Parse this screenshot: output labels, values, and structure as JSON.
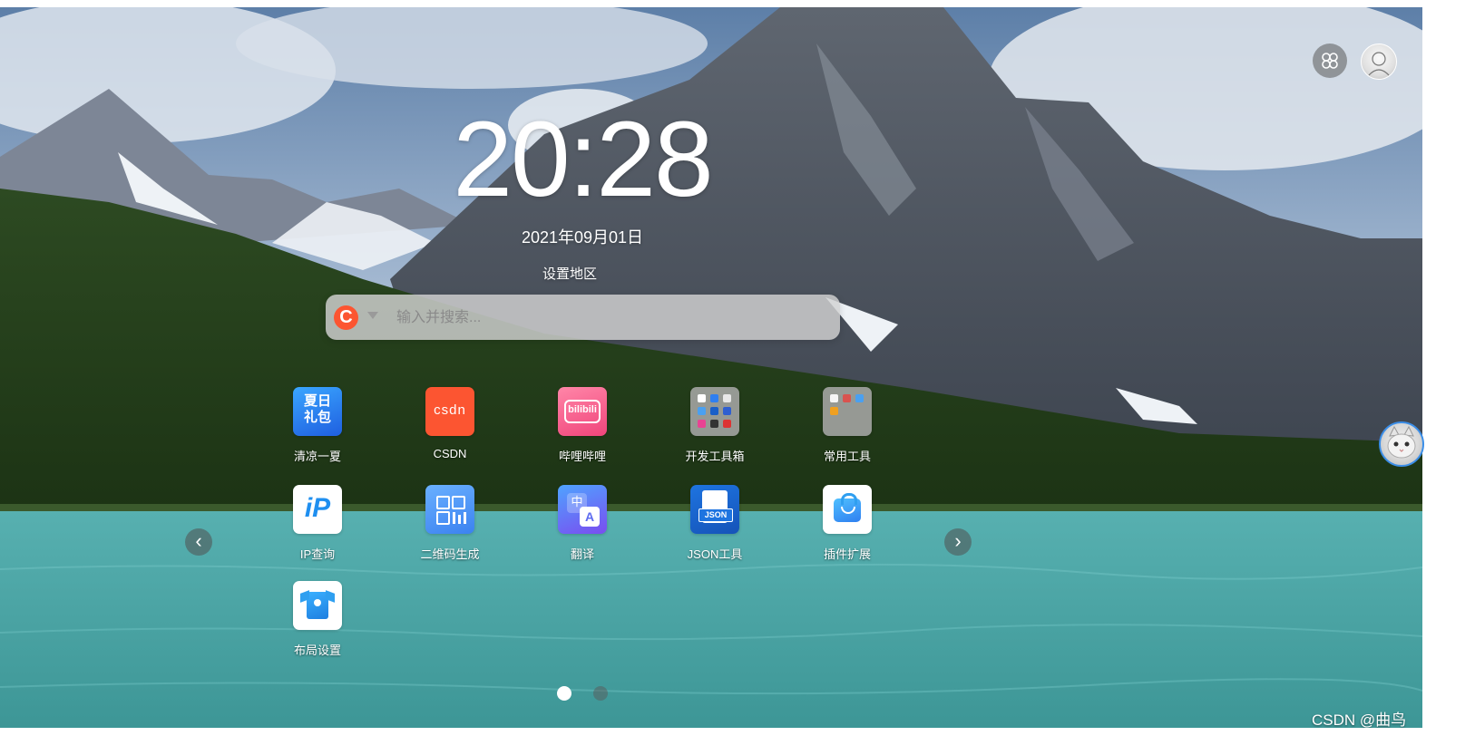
{
  "clock": {
    "time": "20:28",
    "date": "2021年09月01日",
    "region_label": "设置地区"
  },
  "search": {
    "engine_letter": "C",
    "engine_color": "#fc5531",
    "placeholder": "输入并搜索..."
  },
  "apps": [
    {
      "label": "清凉一夏",
      "icon": "summer-gift-icon",
      "icon_text": "夏日礼包",
      "color": "#2f7ff0"
    },
    {
      "label": "CSDN",
      "icon": "csdn-icon",
      "icon_text": "CSDN",
      "color": "#fc5531"
    },
    {
      "label": "哔哩哔哩",
      "icon": "bilibili-icon",
      "icon_text": "bilibili",
      "color": "#fb7299"
    },
    {
      "label": "开发工具箱",
      "icon": "dev-toolbox-folder-icon",
      "color": "#9a9a9a"
    },
    {
      "label": "常用工具",
      "icon": "common-tools-folder-icon",
      "color": "#9a9a9a"
    },
    {
      "label": "IP查询",
      "icon": "ip-lookup-icon",
      "icon_text": "iP",
      "color": "#ffffff"
    },
    {
      "label": "二维码生成",
      "icon": "qrcode-icon",
      "color": "#4b95f5"
    },
    {
      "label": "翻译",
      "icon": "translate-icon",
      "icon_text": "中A",
      "color": "#5e6cf0"
    },
    {
      "label": "JSON工具",
      "icon": "json-tool-icon",
      "icon_text": "JSON",
      "color": "#1a5fc8"
    },
    {
      "label": "插件扩展",
      "icon": "plugin-bag-icon",
      "color": "#ffffff"
    },
    {
      "label": "布局设置",
      "icon": "layout-shirt-icon",
      "color": "#ffffff"
    }
  ],
  "pagination": {
    "current_page": 1,
    "total_pages": 2
  },
  "watermark": "CSDN @曲鸟"
}
